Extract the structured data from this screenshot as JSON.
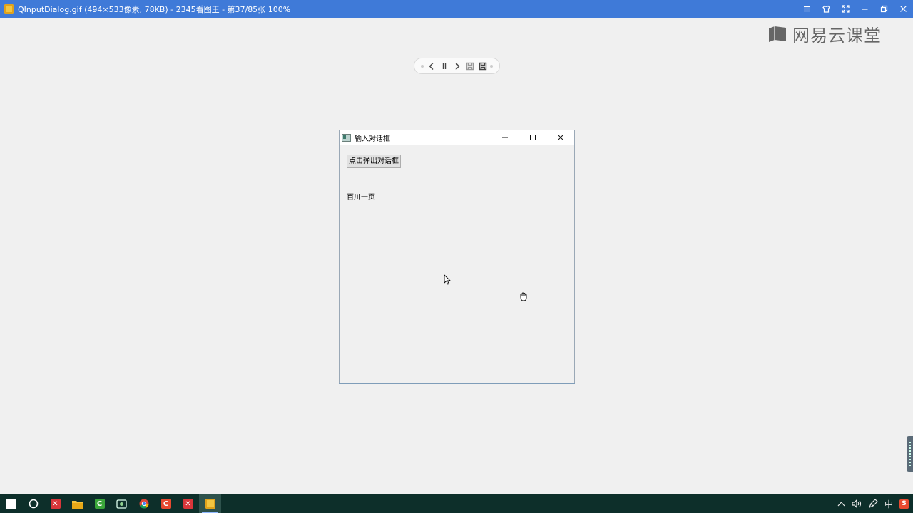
{
  "viewer": {
    "title": "QInputDialog.gif  (494×533像素, 78KB)  - 2345看图王 - 第37/85张 100%",
    "accent_color": "#3f7ad8",
    "controls": [
      "menu-icon",
      "skin-icon",
      "fullscreen-icon",
      "minimize-icon",
      "restore-icon",
      "close-icon"
    ]
  },
  "watermark": {
    "text": "网易云课堂"
  },
  "toolbar": {
    "buttons": [
      "previous-icon",
      "pause-icon",
      "next-icon",
      "save-icon",
      "save-as-icon"
    ]
  },
  "qt_window": {
    "title": "输入对话框",
    "controls": [
      "minimize-icon",
      "maximize-icon",
      "close-icon"
    ],
    "button_label": "点击弹出对话框",
    "label_text": "百川一页"
  },
  "taskbar": {
    "apps": [
      "windows-start-icon",
      "cortana-icon",
      "xmind-icon",
      "file-explorer-icon",
      "camtasia-icon",
      "screenshot-tool-icon",
      "chrome-icon",
      "app-c-icon",
      "xmind-red-icon",
      "image-viewer-icon"
    ],
    "tray": {
      "ime": "中"
    }
  }
}
